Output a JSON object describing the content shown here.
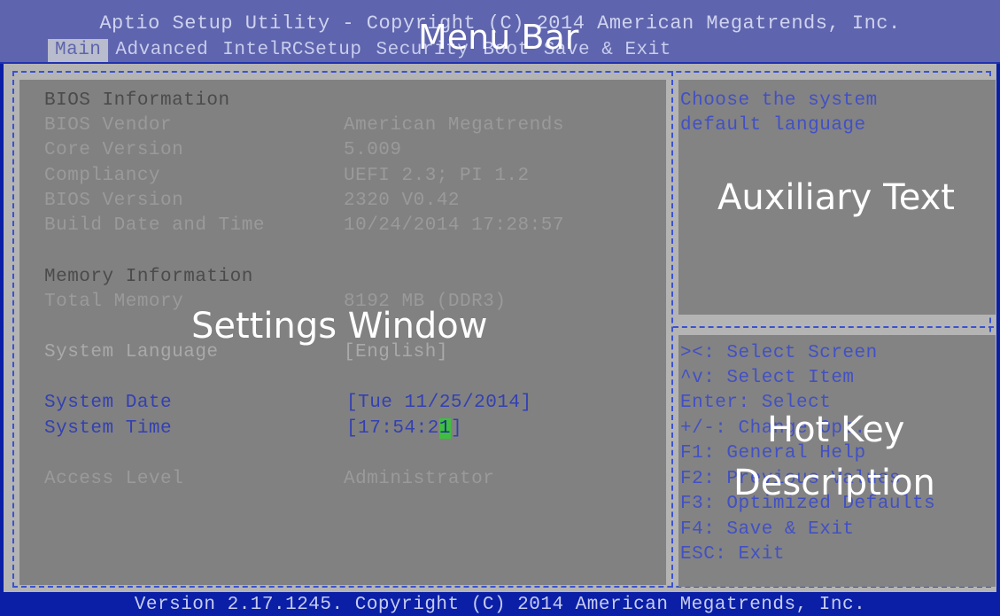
{
  "title": "Aptio Setup Utility - Copyright (C) 2014 American Megatrends, Inc.",
  "menu": [
    "Main",
    "Advanced",
    "IntelRCSetup",
    "Security",
    "Boot",
    "Save & Exit"
  ],
  "sections": {
    "bios_heading": "BIOS Information",
    "memory_heading": "Memory Information"
  },
  "bios_info": [
    {
      "label": "BIOS Vendor",
      "value": "American Megatrends"
    },
    {
      "label": "Core Version",
      "value": "5.009"
    },
    {
      "label": "Compliancy",
      "value": "UEFI 2.3; PI 1.2"
    },
    {
      "label": "BIOS Version",
      "value": "2320 V0.42"
    },
    {
      "label": "Build Date and Time",
      "value": "10/24/2014 17:28:57"
    }
  ],
  "memory": {
    "label": "Total Memory",
    "value": "8192 MB (DDR3)"
  },
  "system_language": {
    "label": "System Language",
    "value": "[English]"
  },
  "system_date": {
    "label": "System Date",
    "value": "[Tue 11/25/2014]"
  },
  "system_time": {
    "label": "System Time",
    "value_prefix": "[17:54:2",
    "value_cursor": "1",
    "value_suffix": "]"
  },
  "access_level": {
    "label": "Access Level",
    "value": "Administrator"
  },
  "help_text": [
    "Choose the system",
    "default language"
  ],
  "hotkeys": [
    "><: Select Screen",
    "^v: Select Item",
    "Enter: Select",
    "+/-: Change Opt.",
    "F1: General Help",
    "F2: Previous Values",
    "F3: Optimized Defaults",
    "F4: Save & Exit",
    "ESC: Exit"
  ],
  "overlay_labels": {
    "menu_bar": "Menu Bar",
    "settings_window": "Settings Window",
    "auxiliary_text": "Auxiliary Text",
    "hot_key_line1": "Hot Key",
    "hot_key_line2": "Description"
  },
  "footer": "Version 2.17.1245. Copyright (C) 2014 American Megatrends, Inc.",
  "colors": {
    "background": "#0a1fa6",
    "menu_bar": "#5e64ad",
    "panel": "#818181",
    "highlight_text": "#3340b2",
    "cursor": "#3fbe3f"
  }
}
